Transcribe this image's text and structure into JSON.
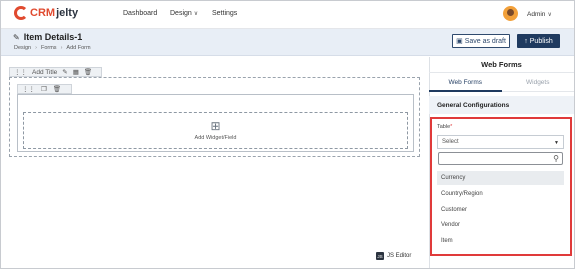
{
  "app": {
    "logo_a": "CRM",
    "logo_b": "jelty"
  },
  "nav": {
    "dashboard": "Dashboard",
    "design": "Design",
    "settings": "Settings"
  },
  "user": {
    "name": "Admin"
  },
  "header": {
    "title": "Item Details-1",
    "breadcrumb": [
      "Design",
      "Forms",
      "Add Form"
    ],
    "save_draft": "Save as draft",
    "publish": "Publish"
  },
  "canvas": {
    "section_title": "Add Title",
    "add_widget_label": "Add Widget/Field",
    "js_editor": "JS Editor"
  },
  "panel": {
    "title": "Web Forms",
    "tabs": [
      "Web Forms",
      "Widgets"
    ],
    "section": "General Configurations",
    "table_label": "Table",
    "required_mark": "*",
    "select_placeholder": "Select",
    "options": [
      "Currency",
      "Country/Region",
      "Customer",
      "Vendor",
      "Item"
    ]
  },
  "colors": {
    "brand": "#e04a2f",
    "primary": "#1f3a5f",
    "highlight": "#e03a3a"
  }
}
